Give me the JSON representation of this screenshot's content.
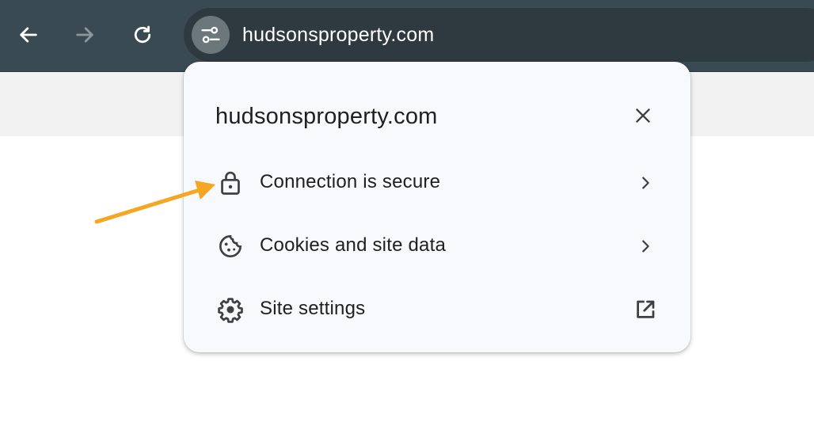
{
  "browser": {
    "url": "hudsonsproperty.com",
    "back_icon": "arrow-left-icon",
    "forward_icon": "arrow-right-icon",
    "reload_icon": "reload-icon",
    "site_info_icon": "tune-icon"
  },
  "popup": {
    "title": "hudsonsproperty.com",
    "close_icon": "close-icon",
    "items": [
      {
        "label": "Connection is secure",
        "icon": "lock-icon",
        "trailing": "chevron-right-icon"
      },
      {
        "label": "Cookies and site data",
        "icon": "cookie-icon",
        "trailing": "chevron-right-icon"
      },
      {
        "label": "Site settings",
        "icon": "gear-icon",
        "trailing": "open-in-new-icon"
      }
    ]
  },
  "annotation": {
    "arrow_color": "#f5a623"
  },
  "colors": {
    "toolbar": "#3a4a52",
    "omnibox": "#2e3a40",
    "popup_bg": "#f8f9fd",
    "text": "#1f1f1f"
  }
}
